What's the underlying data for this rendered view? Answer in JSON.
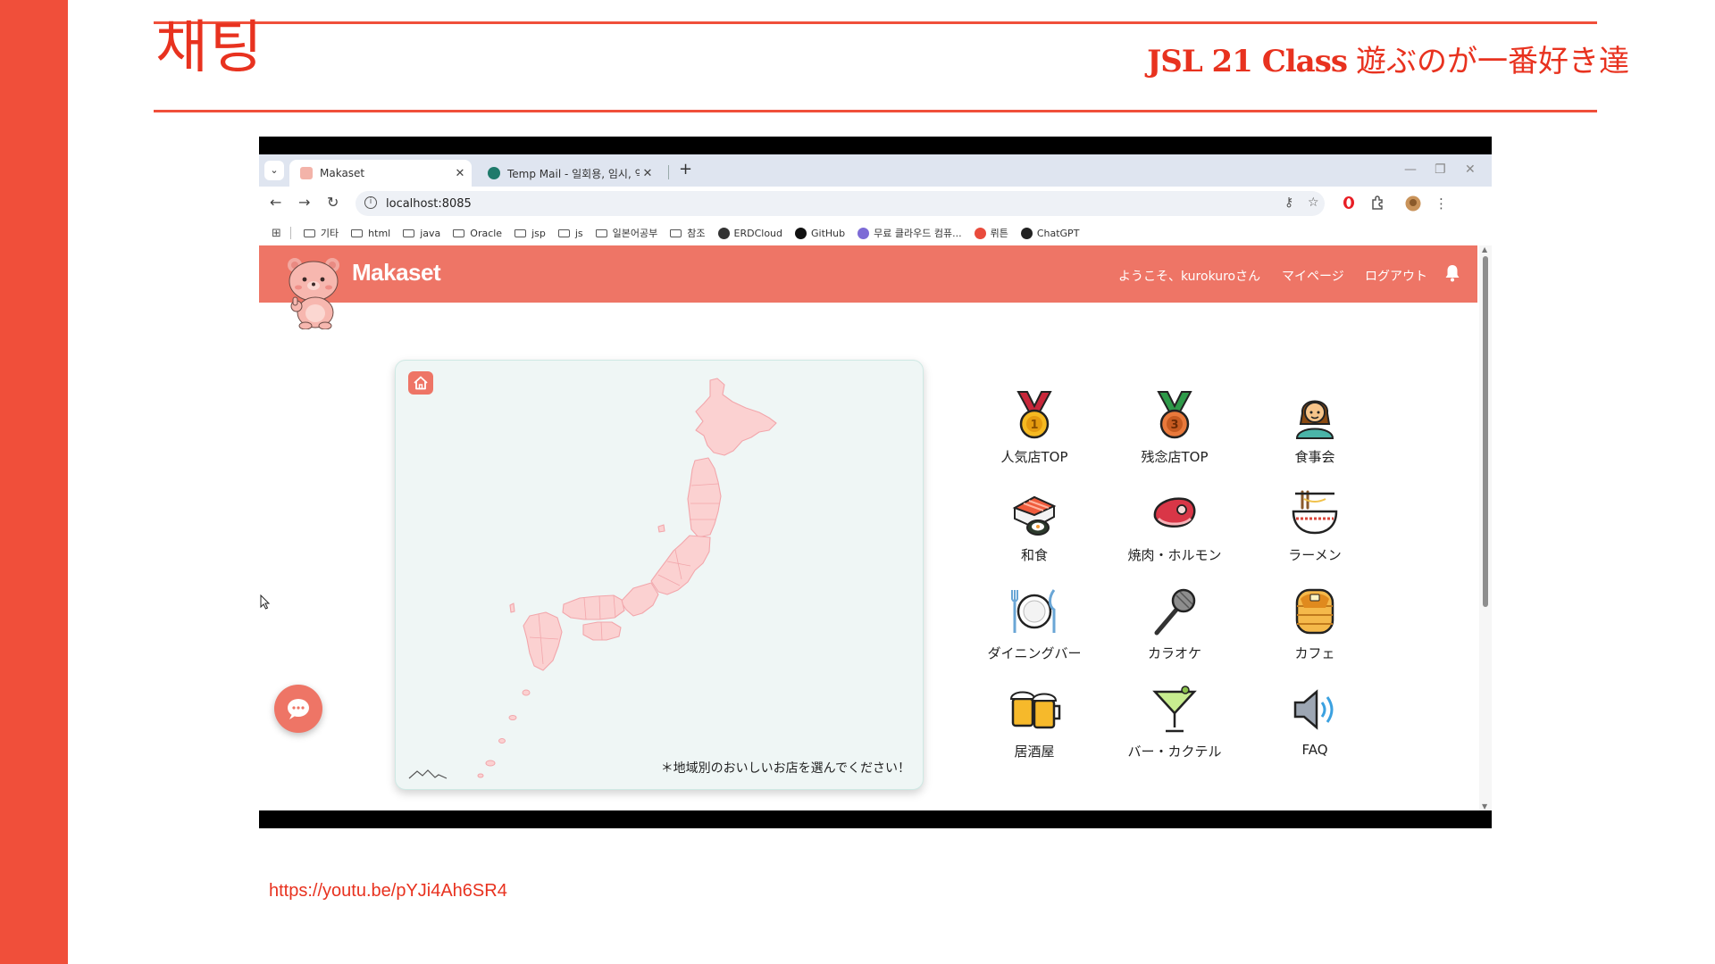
{
  "slide": {
    "title": "채팅",
    "subtitle_class": "JSL 21 Class",
    "subtitle_jp": "遊ぶのが一番好き達",
    "link": "https://youtu.be/pYJi4Ah6SR4",
    "accent_color": "#f04f3a"
  },
  "browser": {
    "tabs": [
      {
        "title": "Makaset",
        "active": true,
        "favicon": "bear-favicon"
      },
      {
        "title": "Temp Mail - 일회용, 임시, 익명",
        "active": false,
        "favicon": "globe-favicon"
      }
    ],
    "new_tab_label": "+",
    "url": "localhost:8085",
    "bookmarks": [
      {
        "label": "기타",
        "type": "folder"
      },
      {
        "label": "html",
        "type": "folder"
      },
      {
        "label": "java",
        "type": "folder"
      },
      {
        "label": "Oracle",
        "type": "folder"
      },
      {
        "label": "jsp",
        "type": "folder"
      },
      {
        "label": "js",
        "type": "folder"
      },
      {
        "label": "일본어공부",
        "type": "folder"
      },
      {
        "label": "참조",
        "type": "folder"
      },
      {
        "label": "ERDCloud",
        "type": "site",
        "color": "#333333"
      },
      {
        "label": "GitHub",
        "type": "site",
        "color": "#111111"
      },
      {
        "label": "무료 클라우드 컴퓨...",
        "type": "site",
        "color": "#7d6bd6"
      },
      {
        "label": "뤼튼",
        "type": "site",
        "color": "#e94b3c"
      },
      {
        "label": "ChatGPT",
        "type": "site",
        "color": "#222222"
      }
    ]
  },
  "site": {
    "brand": "Makaset",
    "header_color": "#ee7566",
    "nav": {
      "welcome": "ようこそ、kurokuroさん",
      "mypage": "マイページ",
      "logout": "ログアウト"
    },
    "map_caption": "＊地域別のおいしいお店を選んでください！",
    "categories": [
      {
        "label": "人気店TOP",
        "icon": "gold-medal-icon"
      },
      {
        "label": "残念店TOP",
        "icon": "bronze-medal-icon"
      },
      {
        "label": "食事会",
        "icon": "woman-person-icon"
      },
      {
        "label": "和食",
        "icon": "sushi-icon"
      },
      {
        "label": "焼肉・ホルモン",
        "icon": "meat-icon"
      },
      {
        "label": "ラーメン",
        "icon": "ramen-bowl-icon"
      },
      {
        "label": "ダイニングバー",
        "icon": "plate-cutlery-icon"
      },
      {
        "label": "カラオケ",
        "icon": "microphone-icon"
      },
      {
        "label": "カフェ",
        "icon": "pancakes-icon"
      },
      {
        "label": "居酒屋",
        "icon": "beer-mugs-icon"
      },
      {
        "label": "バー・カクテル",
        "icon": "cocktail-glass-icon"
      },
      {
        "label": "FAQ",
        "icon": "speaker-icon"
      }
    ]
  }
}
